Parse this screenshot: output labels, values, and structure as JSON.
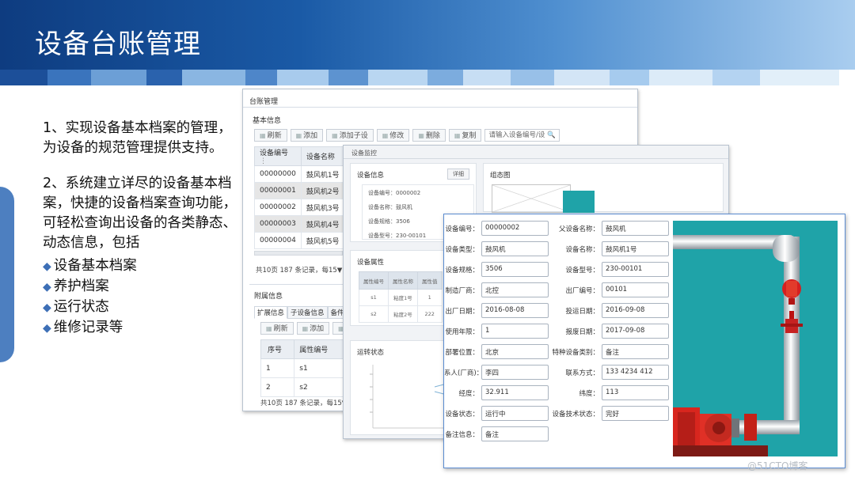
{
  "slide": {
    "title": "设备台账管理",
    "point1": "1、实现设备基本档案的管理，为设备的规范管理提供支持。",
    "point2": "2、系统建立详尽的设备基本档案，快捷的设备档案查询功能，可轻松查询出设备的各类静态、 动态信息，包括",
    "bullets": [
      "设备基本档案",
      "养护档案",
      "运行状态",
      "维修记录等"
    ],
    "watermark": "@51CTO博客"
  },
  "ledger": {
    "title": "台账管理",
    "basic_info": "基本信息",
    "toolbar": [
      "刷新",
      "添加",
      "添加子设",
      "修改",
      "删除",
      "复制"
    ],
    "search_placeholder": "请输入设备编号/设",
    "columns": [
      "设备编号",
      "设备名称"
    ],
    "rows": [
      [
        "00000000",
        "鼓风机1号"
      ],
      [
        "00000001",
        "鼓风机2号"
      ],
      [
        "00000002",
        "鼓风机3号"
      ],
      [
        "00000003",
        "鼓风机4号"
      ],
      [
        "00000004",
        "鼓风机5号"
      ]
    ],
    "pager": "共10页 187 条记录，每15▼ 示",
    "attach": {
      "title": "附属信息",
      "tabs": [
        "扩展信息",
        "子设备信息",
        "备件和工",
        "t"
      ],
      "toolbar": [
        "刷新",
        "添加",
        "修改"
      ],
      "columns": [
        "序号",
        "属性编号"
      ],
      "rows": [
        [
          "1",
          "s1"
        ],
        [
          "2",
          "s2"
        ]
      ],
      "pager": "共10页 187 条记录，每15▼ 示"
    }
  },
  "monitor": {
    "title": "设备监控",
    "info_title": "设备信息",
    "detail_button": "详细",
    "info_lines": [
      "设备编号：0000002",
      "设备名称：鼓风机",
      "设备规格：3506",
      "设备型号：230-00101"
    ],
    "diagram_title": "组态图",
    "attr_title": "设备属性",
    "attr_columns": [
      "属性编号",
      "属性名称",
      "属性值"
    ],
    "attr_rows": [
      [
        "s1",
        "粘度1号",
        "1"
      ],
      [
        "s2",
        "粘度2号",
        "222"
      ]
    ],
    "status_title": "运转状态"
  },
  "detail": {
    "fields_left": [
      {
        "label": "设备编号：",
        "value": "00000002"
      },
      {
        "label": "设备类型：",
        "value": "鼓风机"
      },
      {
        "label": "设备规格：",
        "value": "3506"
      },
      {
        "label": "制造厂商：",
        "value": "北控"
      },
      {
        "label": "出厂日期：",
        "value": "2016-08-08"
      },
      {
        "label": "使用年限：",
        "value": "1"
      },
      {
        "label": "部署位置：",
        "value": "北京"
      },
      {
        "label": "系人(厂商)：",
        "value": "李四"
      },
      {
        "label": "经度：",
        "value": "32.911"
      },
      {
        "label": "设备状态：",
        "value": "运行中"
      },
      {
        "label": "备注信息：",
        "value": "备注"
      }
    ],
    "fields_right": [
      {
        "label": "父设备名称：",
        "value": "鼓风机"
      },
      {
        "label": "设备名称：",
        "value": "鼓风机1号"
      },
      {
        "label": "设备型号：",
        "value": "230-00101"
      },
      {
        "label": "出厂编号：",
        "value": "00101"
      },
      {
        "label": "投运日期：",
        "value": "2016-09-08"
      },
      {
        "label": "报废日期：",
        "value": "2017-09-08"
      },
      {
        "label": "特种设备类别：",
        "value": "备注"
      },
      {
        "label": "联系方式：",
        "value": "133 4234 412"
      },
      {
        "label": "纬度：",
        "value": "113"
      },
      {
        "label": "设备技术状态：",
        "value": "完好"
      }
    ]
  },
  "colors": {
    "banner_dark": "#0e3c80",
    "banner_light": "#a9cdef",
    "accent": "#4d7fc0",
    "pipe_background": "#1fa3a8",
    "valve_red": "#d42020"
  }
}
